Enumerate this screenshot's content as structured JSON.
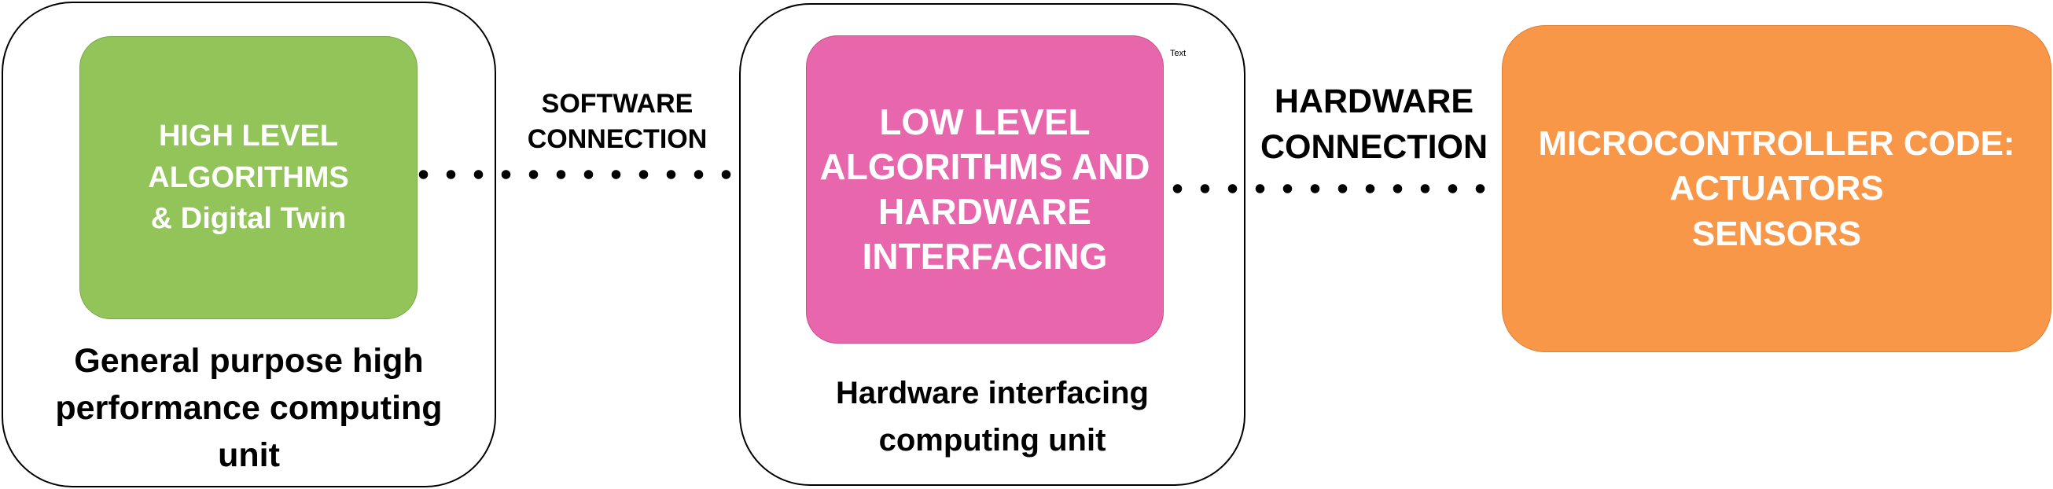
{
  "colors": {
    "green_block": "#92c45a",
    "pink_block": "#e866ab",
    "orange_block": "#f99749",
    "block_text": "#ffffff",
    "outline": "#000000"
  },
  "units": {
    "left": {
      "block_label": "HIGH LEVEL\nALGORITHMS\n& Digital Twin",
      "caption": "General purpose high\nperformance computing\nunit"
    },
    "middle": {
      "block_label": "LOW LEVEL\nALGORITHMS AND\nHARDWARE\nINTERFACING",
      "caption": "Hardware interfacing\ncomputing unit",
      "tiny_label": "Text"
    },
    "right": {
      "block_label": "MICROCONTROLLER CODE:\nACTUATORS\nSENSORS"
    }
  },
  "connections": {
    "software": "SOFTWARE\nCONNECTION",
    "hardware": "HARDWARE\nCONNECTION"
  }
}
